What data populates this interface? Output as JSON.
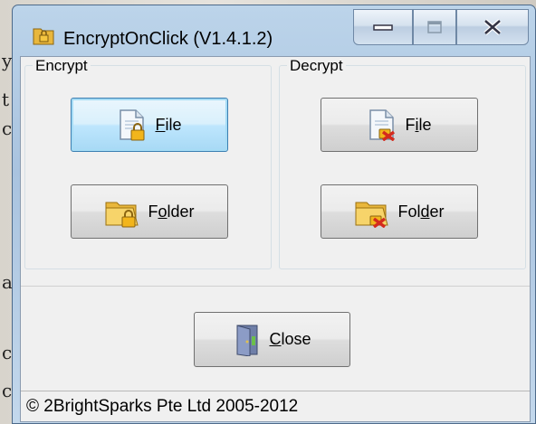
{
  "window": {
    "title": "EncryptOnClick (V1.4.1.2)",
    "icons": {
      "app": "lock-folder-icon",
      "minimize": "minimize-icon",
      "maximize": "maximize-icon",
      "close": "close-icon"
    }
  },
  "encrypt": {
    "label": "Encrypt",
    "file_mnemonic": "F",
    "file_rest": "ile",
    "folder_pre": "F",
    "folder_mnemonic": "o",
    "folder_rest": "lder"
  },
  "decrypt": {
    "label": "Decrypt",
    "file_pre": "F",
    "file_mnemonic": "i",
    "file_rest": "le",
    "folder_pre": "Fol",
    "folder_mnemonic": "d",
    "folder_rest": "er"
  },
  "close_button": {
    "mnemonic": "C",
    "rest": "lose"
  },
  "status": {
    "text": "© 2BrightSparks Pte Ltd 2005-2012"
  },
  "background": {
    "stray_chars": [
      "y",
      "t",
      "c",
      "a",
      "c",
      "c"
    ]
  },
  "colors": {
    "titlebar": "#b4cde6",
    "focus_accent": "#3c7fb1",
    "lock_gold": "#f2b51c",
    "decrypt_x": "#d42b1e"
  }
}
